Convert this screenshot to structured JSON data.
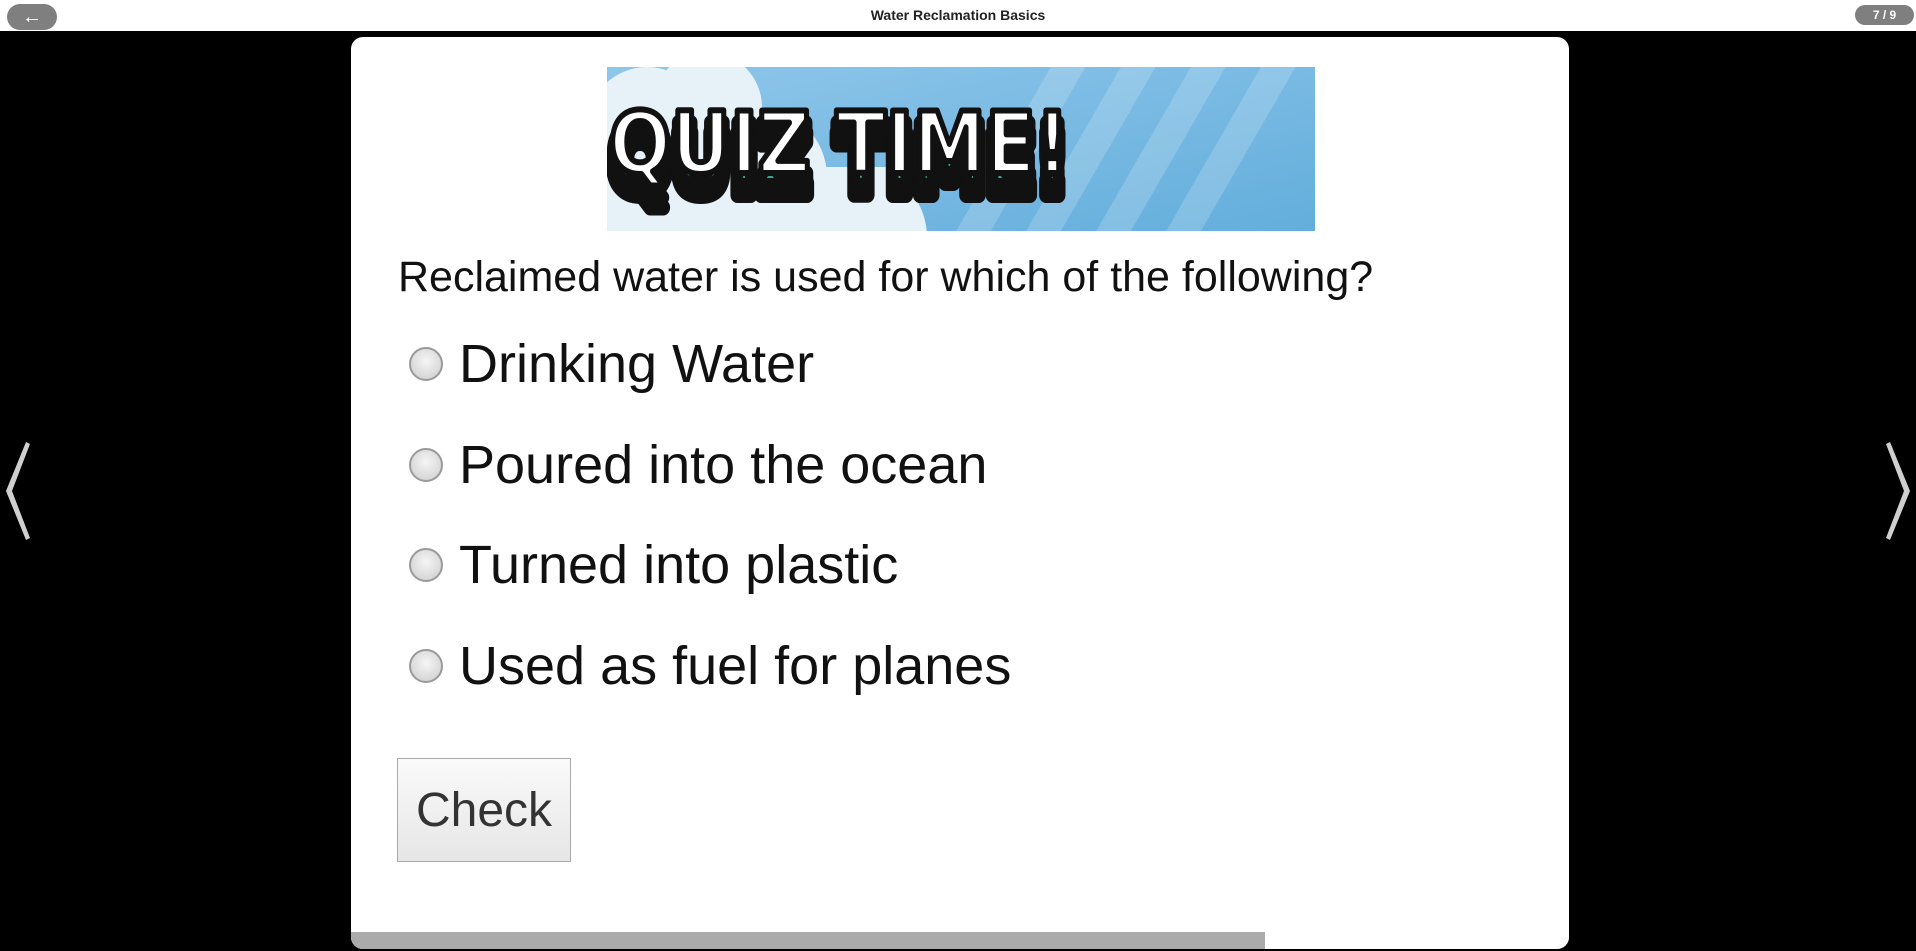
{
  "header": {
    "back_label": "←",
    "title": "Water Reclamation Basics",
    "page_counter": "7 / 9"
  },
  "banner": {
    "text": "QUIZ TIME!",
    "sky_color": "#6fb3de",
    "accent_color": "#3aa39a"
  },
  "quiz": {
    "question": "Reclaimed water is used for which of the following?",
    "options": [
      {
        "label": "Drinking Water",
        "selected": false
      },
      {
        "label": "Poured into the ocean",
        "selected": false
      },
      {
        "label": "Turned into plastic",
        "selected": false
      },
      {
        "label": "Used as fuel for planes",
        "selected": false
      }
    ],
    "check_label": "Check"
  },
  "progress": {
    "fraction": 0.75
  },
  "icons": {
    "prev": "chevron-left-icon",
    "next": "chevron-right-icon",
    "back": "arrow-left-icon"
  }
}
